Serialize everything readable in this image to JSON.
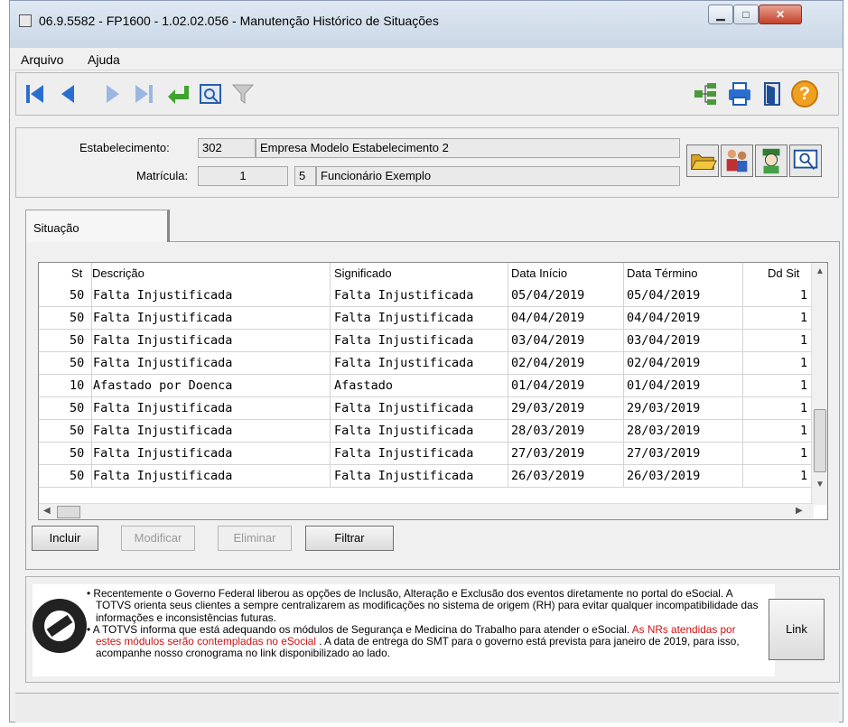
{
  "window": {
    "title": "06.9.5582 - FP1600 - 1.02.02.056 - Manutenção Histórico de Situações",
    "controls": [
      "minimize-icon",
      "maximize-icon",
      "close-icon"
    ]
  },
  "menu": {
    "items": [
      "Arquivo",
      "Ajuda"
    ]
  },
  "toolbar": {
    "left_icons": [
      "first-record-icon",
      "previous-record-icon",
      "next-record-icon",
      "last-record-icon",
      "return-icon",
      "zoom-icon",
      "filter-icon"
    ],
    "right_icons": [
      "hierarchy-icon",
      "print-icon",
      "exit-door-icon",
      "help-icon"
    ],
    "help_label": "?"
  },
  "header": {
    "estabelecimento_label": "Estabelecimento:",
    "estabelecimento_code": "302",
    "estabelecimento_name": "Empresa Modelo Estabelecimento 2",
    "matricula_label": "Matrícula:",
    "matricula_number": "1",
    "matricula_digit": "5",
    "matricula_name": "Funcionário Exemplo",
    "action_icons": [
      "open-folder-icon",
      "people-icon",
      "employee-search-icon",
      "search-image-icon"
    ]
  },
  "tab": {
    "label": "Situação"
  },
  "grid": {
    "columns": [
      "St",
      "Descrição",
      "Significado",
      "Data Início",
      "Data Término",
      "Dd Sit"
    ],
    "rows": [
      {
        "st": "50",
        "descricao": "Falta Injustificada",
        "significado": "Falta Injustificada",
        "inicio": "05/04/2019",
        "termino": "05/04/2019",
        "dd": "1"
      },
      {
        "st": "50",
        "descricao": "Falta Injustificada",
        "significado": "Falta Injustificada",
        "inicio": "04/04/2019",
        "termino": "04/04/2019",
        "dd": "1"
      },
      {
        "st": "50",
        "descricao": "Falta Injustificada",
        "significado": "Falta Injustificada",
        "inicio": "03/04/2019",
        "termino": "03/04/2019",
        "dd": "1"
      },
      {
        "st": "50",
        "descricao": "Falta Injustificada",
        "significado": "Falta Injustificada",
        "inicio": "02/04/2019",
        "termino": "02/04/2019",
        "dd": "1"
      },
      {
        "st": "10",
        "descricao": "Afastado por Doenca",
        "significado": "Afastado",
        "inicio": "01/04/2019",
        "termino": "01/04/2019",
        "dd": "1"
      },
      {
        "st": "50",
        "descricao": "Falta Injustificada",
        "significado": "Falta Injustificada",
        "inicio": "29/03/2019",
        "termino": "29/03/2019",
        "dd": "1"
      },
      {
        "st": "50",
        "descricao": "Falta Injustificada",
        "significado": "Falta Injustificada",
        "inicio": "28/03/2019",
        "termino": "28/03/2019",
        "dd": "1"
      },
      {
        "st": "50",
        "descricao": "Falta Injustificada",
        "significado": "Falta Injustificada",
        "inicio": "27/03/2019",
        "termino": "27/03/2019",
        "dd": "1"
      },
      {
        "st": "50",
        "descricao": "Falta Injustificada",
        "significado": "Falta Injustificada",
        "inicio": "26/03/2019",
        "termino": "26/03/2019",
        "dd": "1"
      }
    ]
  },
  "buttons": {
    "incluir": "Incluir",
    "modificar": "Modificar",
    "eliminar": "Eliminar",
    "filtrar": "Filtrar"
  },
  "news": {
    "item1": "Recentemente o Governo Federal liberou as opções de Inclusão, Alteração e Exclusão dos eventos diretamente no portal do eSocial. A TOTVS orienta seus clientes a sempre centralizarem as modificações no sistema de origem (RH) para evitar qualquer incompatibilidade das informações e inconsistências futuras.",
    "item2_part1": "A TOTVS informa que está adequando os módulos de Segurança e Medicina do Trabalho para atender o eSocial.",
    "item2_red": "As NRs atendidas por estes módulos serão contempladas no eSocial",
    "item2_part2": ". A data de entrega do SMT para o governo está prevista para janeiro de 2019, para isso, acompanhe nosso cronograma no link disponibilizado ao lado."
  },
  "link_button": "Link",
  "colors": {
    "accent_blue": "#1f5fbf",
    "help_orange": "#f0a020",
    "alert_red": "#d01010"
  }
}
